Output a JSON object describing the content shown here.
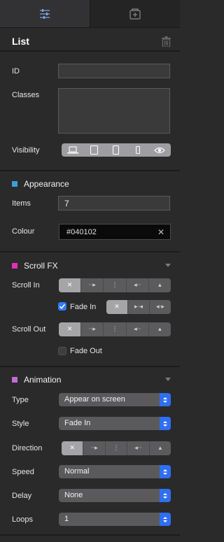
{
  "tabs": [
    {
      "icon": "sliders-icon"
    },
    {
      "icon": "add-box-icon"
    }
  ],
  "panel": {
    "title": "List",
    "delete_icon": "trash-icon"
  },
  "fields": {
    "id_label": "ID",
    "id_value": "",
    "classes_label": "Classes",
    "classes_value": "",
    "visibility_label": "Visibility",
    "visibility_icons": [
      "laptop-icon",
      "tablet-landscape-icon",
      "tablet-portrait-icon",
      "phone-icon",
      "eye-icon"
    ]
  },
  "appearance": {
    "title": "Appearance",
    "accent": "#3a9fd8",
    "items_label": "Items",
    "items_value": "7",
    "colour_label": "Colour",
    "colour_value": "#040102",
    "clear_glyph": "✕"
  },
  "scroll_fx": {
    "title": "Scroll FX",
    "accent": "#e52fb4",
    "scroll_in_label": "Scroll In",
    "fade_in_label": "Fade In",
    "fade_in_checked": true,
    "scroll_out_label": "Scroll Out",
    "fade_out_label": "Fade Out",
    "fade_out_checked": false,
    "direction_glyphs": [
      "✕",
      "‧‧▸",
      "⋮",
      "◂‧‧",
      "▴"
    ],
    "fade_glyphs": [
      "✕",
      "▸‧◂",
      "◂‧▸"
    ]
  },
  "animation": {
    "title": "Animation",
    "accent": "#c56ad9",
    "type_label": "Type",
    "type_value": "Appear on screen",
    "style_label": "Style",
    "style_value": "Fade In",
    "direction_label": "Direction",
    "speed_label": "Speed",
    "speed_value": "Normal",
    "delay_label": "Delay",
    "delay_value": "None",
    "loops_label": "Loops",
    "loops_value": "1"
  }
}
